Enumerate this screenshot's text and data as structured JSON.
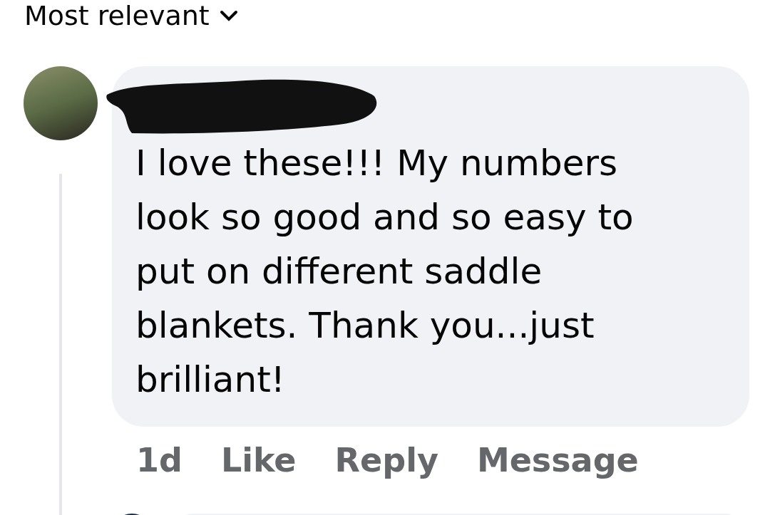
{
  "sort": {
    "label": "Most relevant"
  },
  "comment": {
    "text": "I love these!!! My numbers look so good and so easy to put on different saddle blankets. Thank you...just brilliant!",
    "time": "1d",
    "actions": [
      "Like",
      "Reply",
      "Message"
    ]
  }
}
